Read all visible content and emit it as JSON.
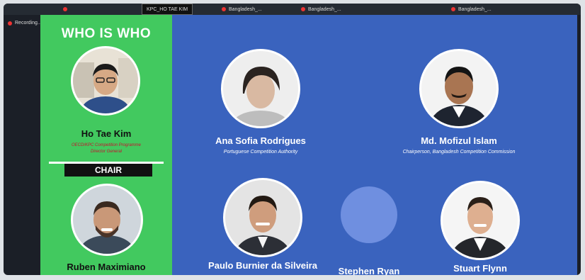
{
  "topbar": {
    "thumbs": [
      {
        "label": "KPC_HO TAE KIM"
      },
      {
        "label": "Bangladesh_..."
      },
      {
        "label": "Bangladesh_..."
      },
      {
        "label": "Bangladesh_..."
      }
    ],
    "recording_label": "Recording..."
  },
  "sidebar": {
    "title": "WHO IS WHO",
    "host": {
      "name": "Ho Tae Kim",
      "role_line1": "OECD/KPC Competition Programme",
      "role_line2": "Director General"
    },
    "chair_label": "CHAIR",
    "chair": {
      "name": "Ruben Maximiano"
    }
  },
  "panelists": [
    {
      "name": "Ana Sofia Rodrigues",
      "role": "Portuguese Competition Authority"
    },
    {
      "name": "Md. Mofizul Islam",
      "role": "Chairperson, Bangladesh Competition Commission"
    },
    {
      "name": "Paulo Burnier da Silveira",
      "role": ""
    },
    {
      "name": "Stephen Ryan",
      "role": ""
    },
    {
      "name": "Stuart Flynn",
      "role": ""
    }
  ],
  "colors": {
    "sidebar": "#42c95f",
    "main": "#3a63be",
    "chair_badge": "#111111",
    "role_text": "#c8102e"
  }
}
